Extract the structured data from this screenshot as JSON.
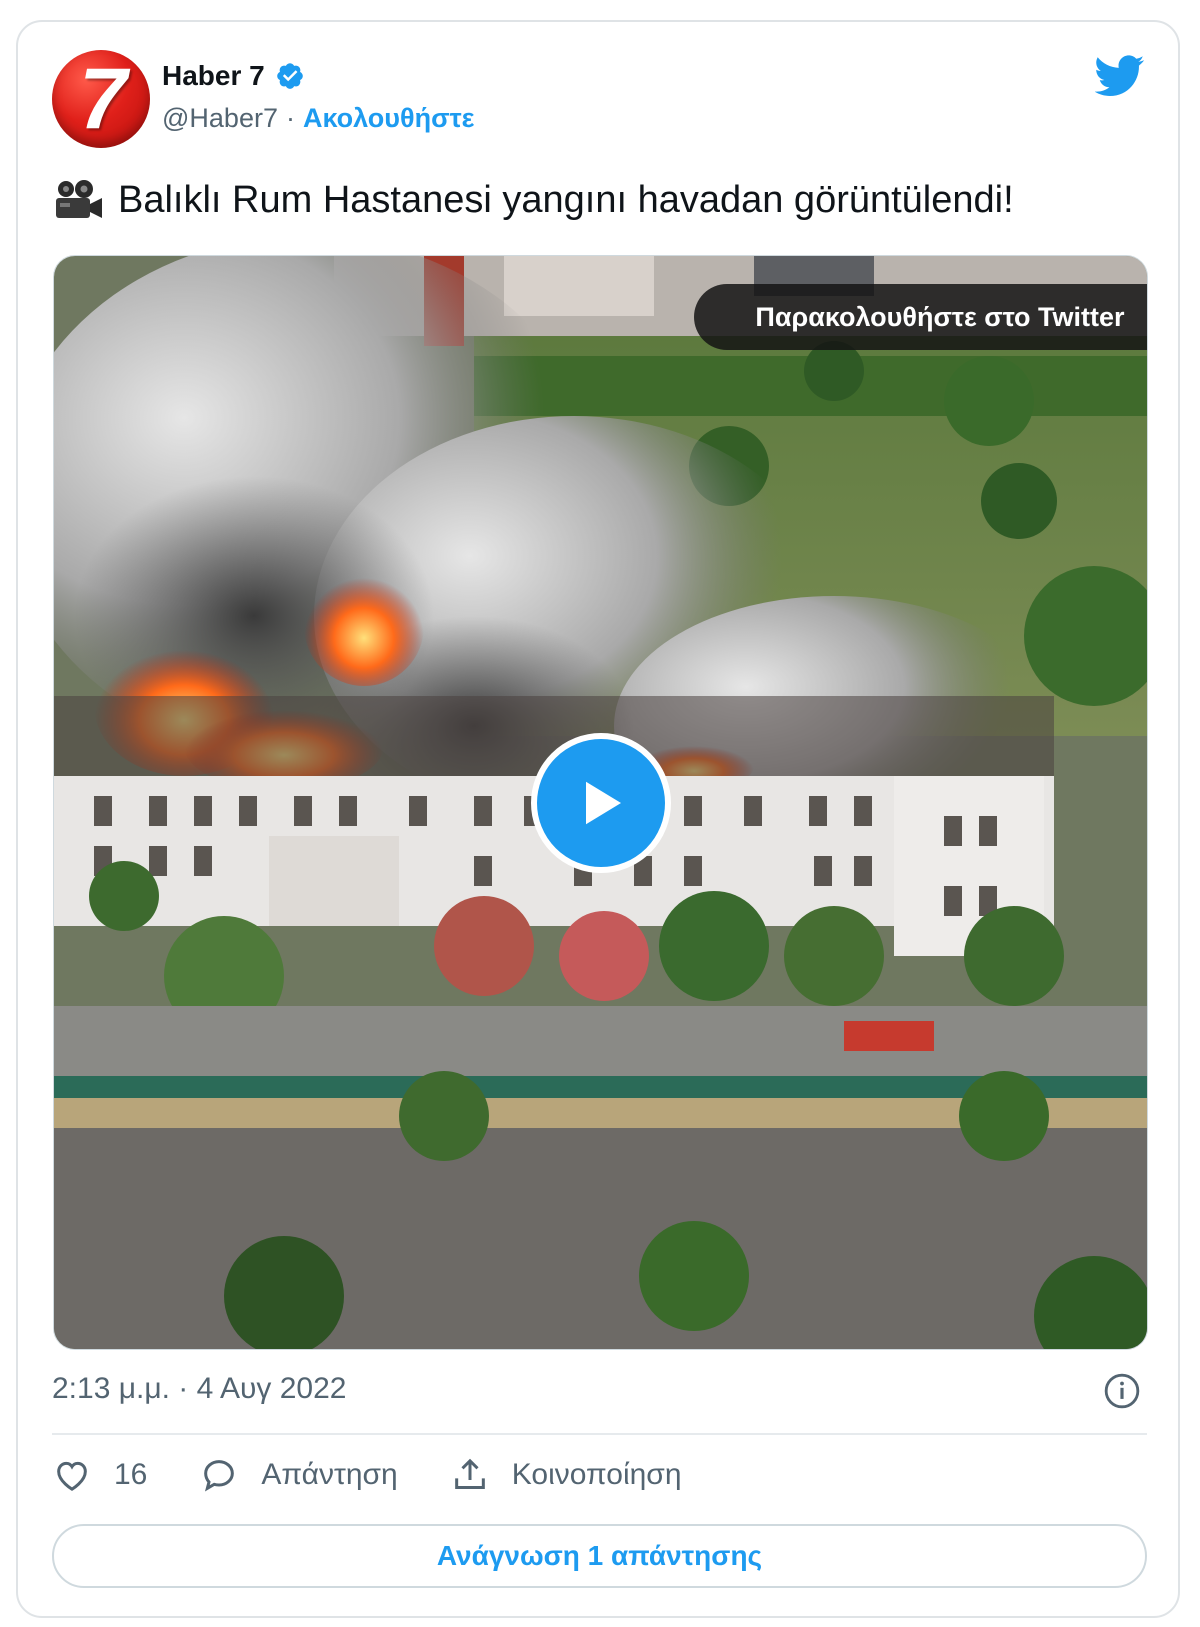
{
  "account": {
    "name": "Haber 7",
    "handle": "@Haber7",
    "separator": "·",
    "follow_label": "Ακολουθήστε",
    "avatar_text": "7",
    "verified": true
  },
  "tweet": {
    "text": "Balıklı Rum Hastanesi yangını havadan görüntülendi!",
    "emoji_icon": "movie-camera-icon"
  },
  "media": {
    "watch_label": "Παρακολουθήστε στο Twitter",
    "type": "video"
  },
  "meta": {
    "timestamp": "2:13 μ.μ. · 4 Αυγ 2022"
  },
  "actions": {
    "like_count": "16",
    "reply_label": "Απάντηση",
    "share_label": "Κοινοποίηση"
  },
  "read_replies_label": "Ανάγνωση 1 απάντησης",
  "colors": {
    "accent": "#1d9bf0",
    "text": "#0f1419",
    "secondary": "#536471",
    "brand_red": "#e0201a"
  }
}
